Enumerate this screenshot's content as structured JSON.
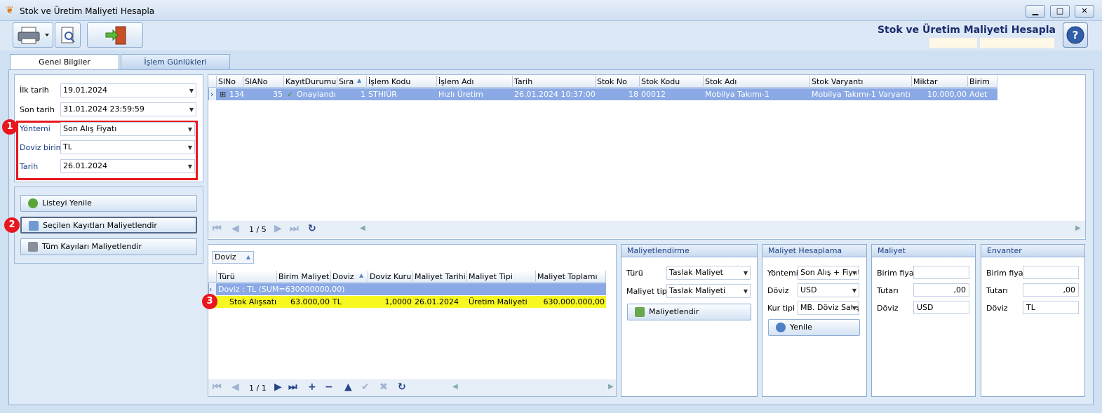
{
  "window": {
    "title": "Stok ve Üretim Maliyeti Hesapla"
  },
  "header": {
    "title": "Stok ve Üretim Maliyeti Hesapla"
  },
  "tabs": [
    {
      "label": "Genel Bilgiler"
    },
    {
      "label": "İşlem Günlükleri"
    }
  ],
  "filters": {
    "ilk_tarih": {
      "label": "İlk tarih",
      "value": "19.01.2024"
    },
    "son_tarih": {
      "label": "Son tarih",
      "value": "31.01.2024 23:59:59"
    },
    "yontem": {
      "label": "Yöntemi",
      "value": "Son Alış Fiyatı"
    },
    "doviz": {
      "label": "Doviz birimi",
      "value": "TL"
    },
    "tarih": {
      "label": "Tarih",
      "value": "26.01.2024"
    }
  },
  "actions": {
    "refresh": "Listeyi Yenile",
    "cost_selected": "Seçilen Kayıtları Maliyetlendir",
    "cost_all": "Tüm Kayıları Maliyetlendir"
  },
  "markers": [
    "1",
    "2",
    "3"
  ],
  "main_grid": {
    "columns": [
      "SlNo",
      "SlANo",
      "KayıtDurumu",
      "Sıra",
      "İşlem Kodu",
      "İşlem Adı",
      "Tarih",
      "Stok No",
      "Stok Kodu",
      "Stok Adı",
      "Stok Varyantı",
      "Miktar",
      "Birim"
    ],
    "rows": [
      {
        "SlNo": "134",
        "SlANo": "35",
        "KayitDurumu": "Onaylandı",
        "Sira": "1",
        "IslemKodu": "STHIÜR",
        "IslemAdi": "Hızlı Üretim",
        "Tarih": "26.01.2024 10:37:00",
        "StokNo": "18",
        "StokKodu": "00012",
        "StokAdi": "Mobilya Takımı-1",
        "StokVaryanti": "Mobilya Takımı-1 Varyantı",
        "Miktar": "10.000,00",
        "Birim": "Adet"
      }
    ],
    "pager": "1 / 5"
  },
  "detail_grid": {
    "group_by": "Doviz",
    "columns": [
      "Türü",
      "Birim Maliyet",
      "Doviz",
      "Doviz Kuru",
      "Maliyet Tarihi",
      "Maliyet Tipi",
      "Maliyet Toplamı"
    ],
    "group_row": "Doviz : TL (SUM=630000000,00)",
    "rows": [
      {
        "Turu": "Stok Alışsatış",
        "BirimMaliyet": "63.000,00",
        "Doviz": "TL",
        "DovizKuru": "1,0000",
        "MaliyetTarihi": "26.01.2024",
        "MaliyetTipi": "Üretim Maliyeti",
        "MaliyetToplami": "630.000.000,00"
      }
    ],
    "pager": "1 / 1"
  },
  "maliyetlendirme": {
    "title": "Maliyetlendirme",
    "turu_label": "Türü",
    "turu_value": "Taslak Maliyet",
    "tip_label": "Maliyet tipi",
    "tip_value": "Taslak Maliyeti",
    "button": "Maliyetlendir"
  },
  "maliyet_hesaplama": {
    "title": "Maliyet Hesaplama",
    "yontem_label": "Yöntemi",
    "yontem_value": "Son Alış + Fiyat",
    "doviz_label": "Döviz",
    "doviz_value": "USD",
    "kur_label": "Kur tipi",
    "kur_value": "MB. Döviz Satış",
    "button": "Yenile"
  },
  "maliyet": {
    "title": "Maliyet",
    "birim_label": "Birim fiyat",
    "birim_value": "",
    "tutar_label": "Tutarı",
    "tutar_value": ",00",
    "doviz_label": "Döviz",
    "doviz_value": "USD"
  },
  "envanter": {
    "title": "Envanter",
    "birim_label": "Birim fiyat",
    "birim_value": "",
    "tutar_label": "Tutarı",
    "tutar_value": ",00",
    "doviz_label": "Döviz",
    "doviz_value": "TL"
  },
  "colors": {
    "accent_row": "#8aa9e5",
    "highlight_row": "#f8f821",
    "marker": "#e8161e",
    "title": "#1a2a6b"
  }
}
